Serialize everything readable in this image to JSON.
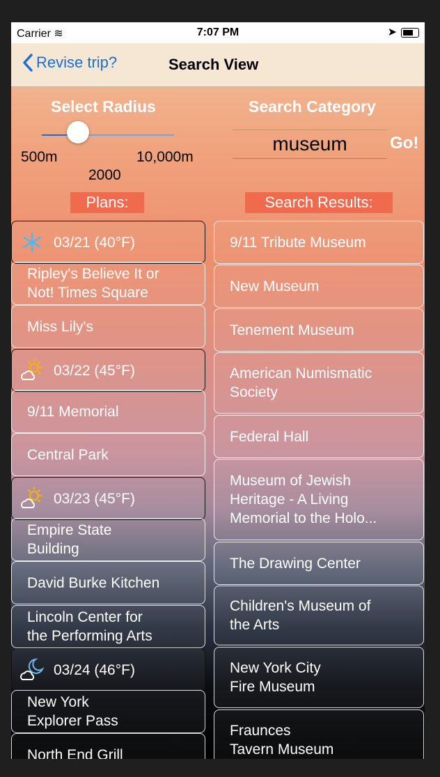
{
  "status_bar": {
    "carrier": "Carrier",
    "time": "7:07 PM"
  },
  "nav": {
    "back_label": "Revise trip?",
    "title": "Search View"
  },
  "radius": {
    "title": "Select Radius",
    "min_label": "500m",
    "max_label": "10,000m",
    "value_label": "2000",
    "value": 2000
  },
  "category": {
    "title": "Search Category",
    "value": "museum",
    "go_label": "Go!"
  },
  "plans": {
    "title": "Plans:",
    "rows": [
      {
        "type": "day",
        "icon": "snowflake-icon",
        "text": "03/21 (40°F)"
      },
      {
        "type": "place",
        "text": "Ripley's Believe It or\nNot! Times Square"
      },
      {
        "type": "place",
        "text": "Miss Lily's"
      },
      {
        "type": "day",
        "icon": "partly-sunny-icon",
        "text": "03/22 (45°F)"
      },
      {
        "type": "place",
        "text": "9/11 Memorial"
      },
      {
        "type": "place",
        "text": "Central Park"
      },
      {
        "type": "day",
        "icon": "partly-sunny-icon",
        "text": "03/23 (45°F)"
      },
      {
        "type": "place",
        "text": "Empire State\nBuilding"
      },
      {
        "type": "place",
        "text": "David Burke Kitchen"
      },
      {
        "type": "place",
        "text": "Lincoln Center for\nthe Performing Arts"
      },
      {
        "type": "day",
        "icon": "cloudy-night-icon",
        "text": "03/24 (46°F)"
      },
      {
        "type": "place",
        "text": "New York\nExplorer Pass"
      },
      {
        "type": "place",
        "text": "North End Grill"
      }
    ]
  },
  "results": {
    "title": "Search Results:",
    "rows": [
      "9/11 Tribute Museum",
      "New Museum",
      "Tenement Museum",
      "American Numismatic\nSociety",
      "Federal Hall",
      "Museum of Jewish\nHeritage - A Living\nMemorial to the Holo...",
      "The Drawing Center",
      "Children's Museum of\nthe Arts",
      "New York City\nFire Museum",
      "Fraunces\nTavern Museum"
    ]
  },
  "colors": {
    "accent": "#1a6fd6",
    "tag": "#f06a4e"
  }
}
